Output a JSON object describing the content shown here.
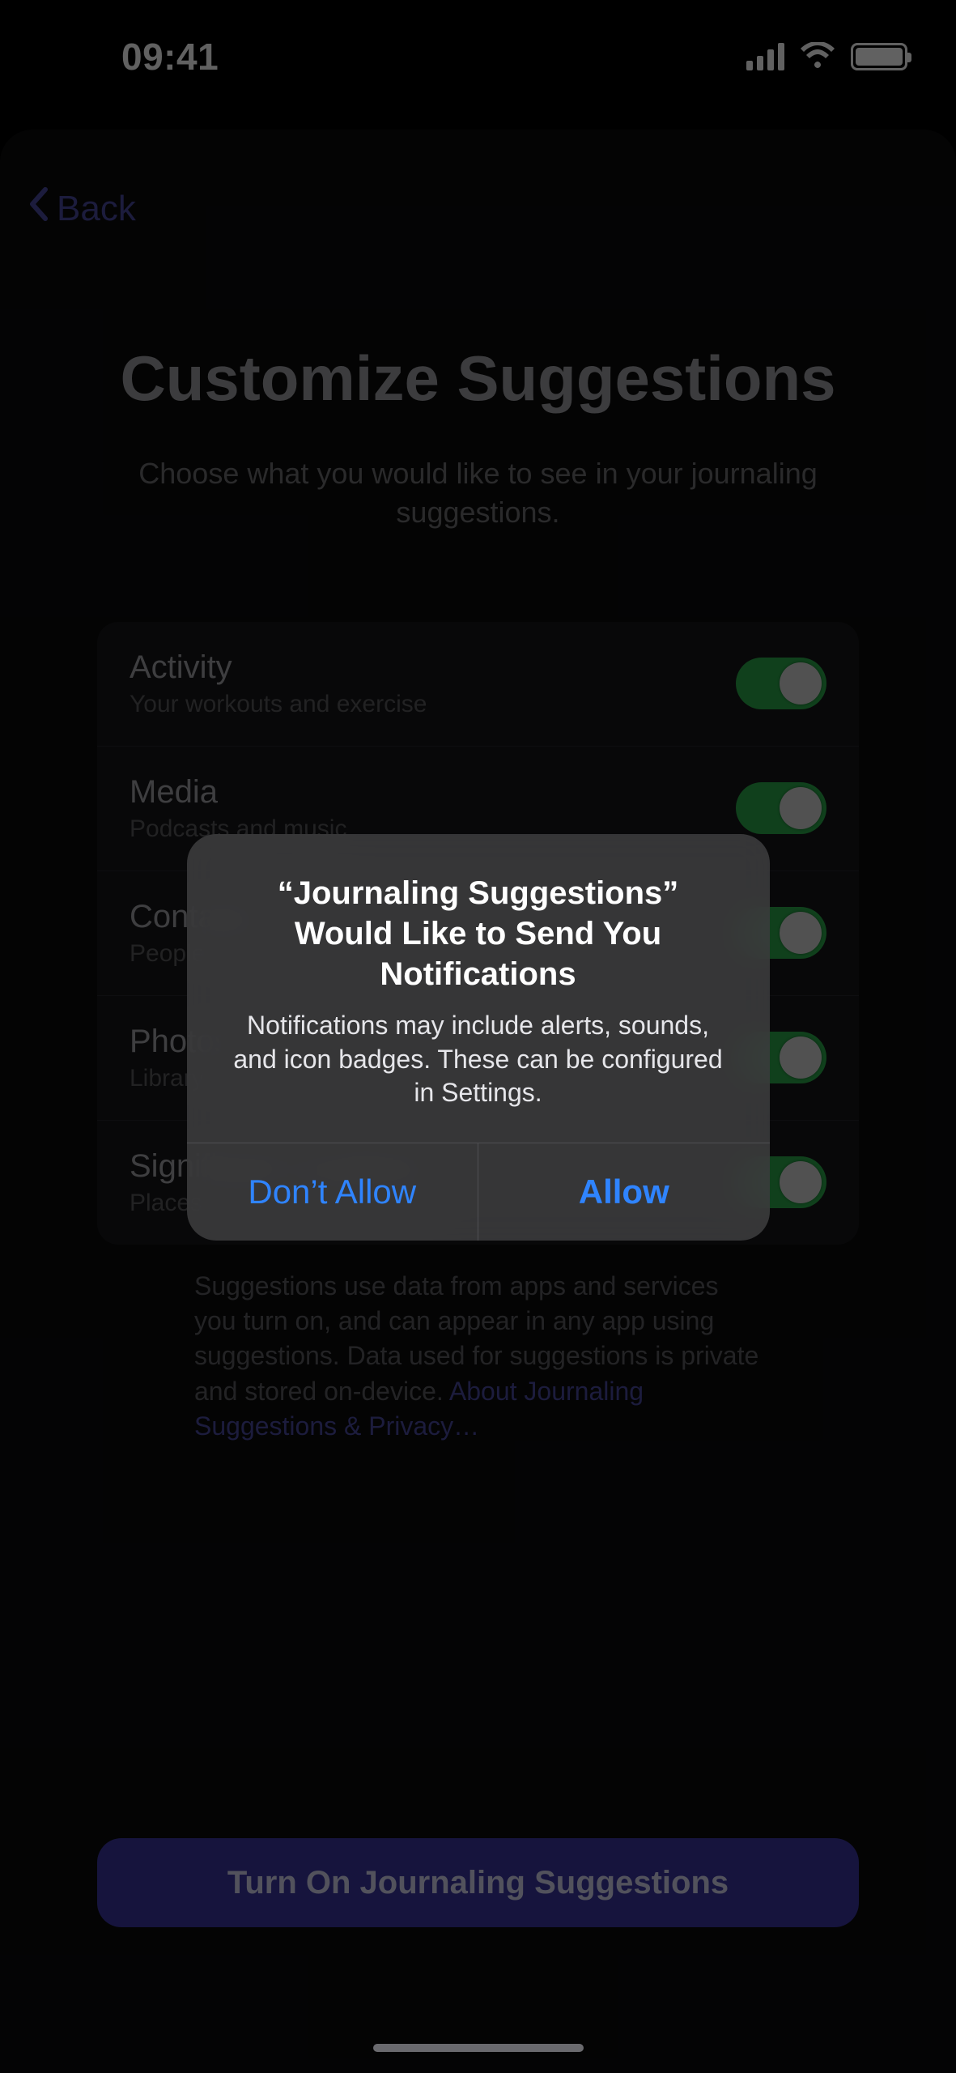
{
  "status": {
    "time": "09:41"
  },
  "nav": {
    "back_label": "Back"
  },
  "header": {
    "title": "Customize Suggestions",
    "subtitle": "Choose what you would like to see in your journaling suggestions."
  },
  "settings": {
    "rows": [
      {
        "title": "Activity",
        "subtitle": "Your workouts and exercise",
        "on": true
      },
      {
        "title": "Media",
        "subtitle": "Podcasts and music",
        "on": true
      },
      {
        "title": "Contacts",
        "subtitle": "People you message and call",
        "on": true
      },
      {
        "title": "Photos",
        "subtitle": "Library and Memories",
        "on": true
      },
      {
        "title": "Significant Locations",
        "subtitle": "Places where you spend time",
        "on": true
      }
    ],
    "footer_text": "Suggestions use data from apps and services you turn on, and can appear in any app using suggestions. Data used for suggestions is private and stored on-device. ",
    "footer_link": "About Journaling Suggestions & Privacy…"
  },
  "cta": {
    "label": "Turn On Journaling Suggestions"
  },
  "alert": {
    "title": "“Journaling Suggestions” Would Like to Send You Notifications",
    "message": "Notifications may include alerts, sounds, and icon badges. These can be configured in Settings.",
    "deny": "Don’t Allow",
    "allow": "Allow"
  }
}
